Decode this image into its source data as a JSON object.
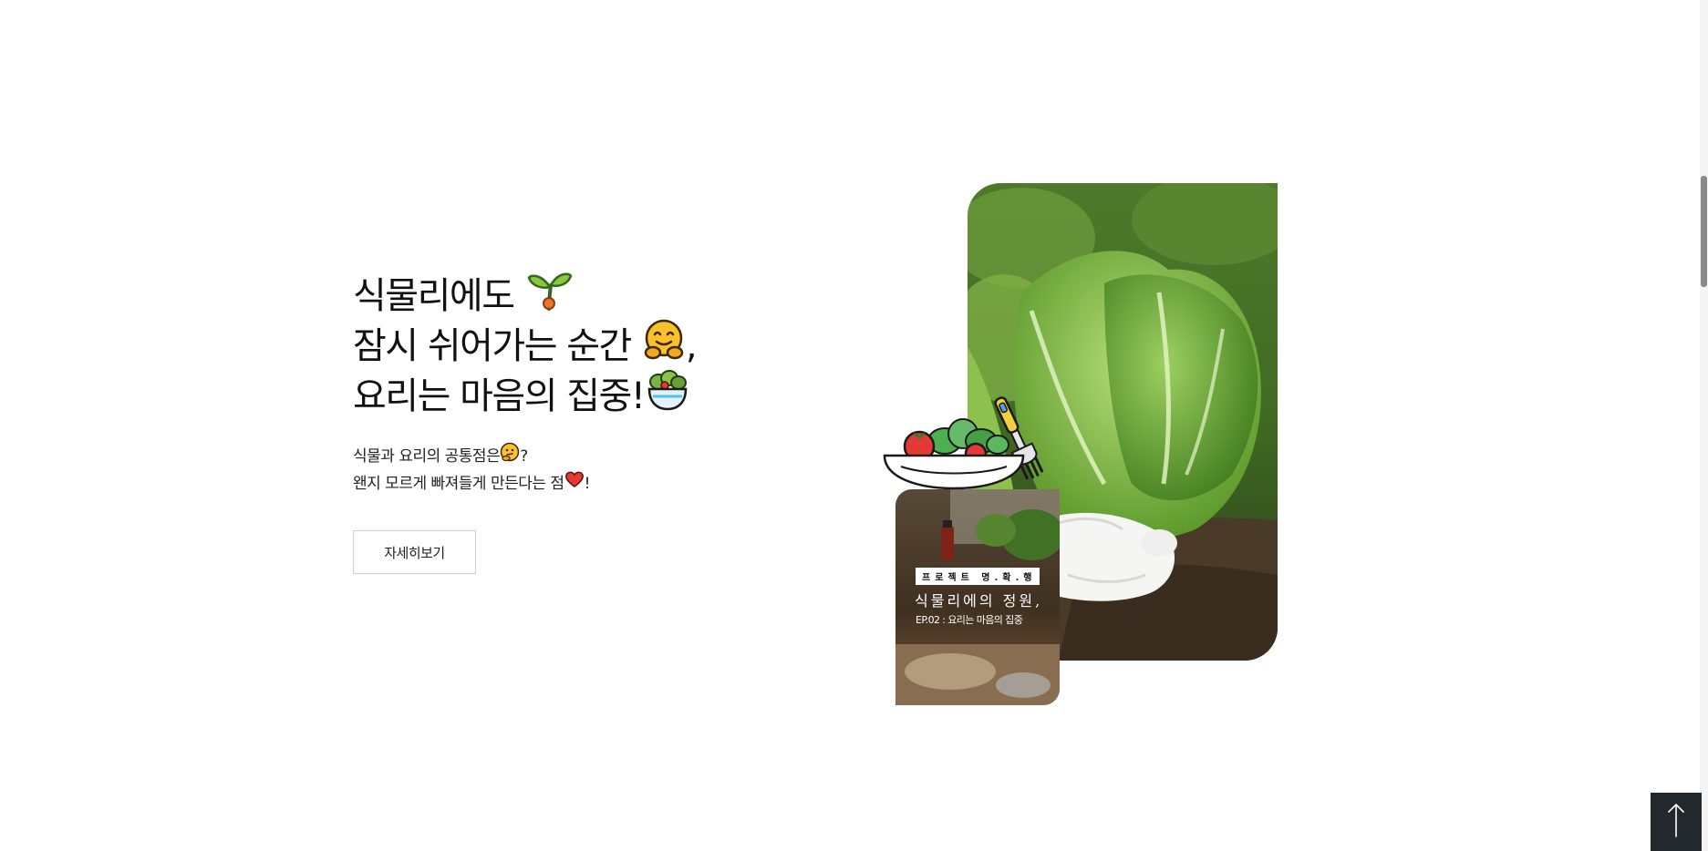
{
  "hero": {
    "headline_lines": [
      {
        "text": "식물리에도",
        "emoji": "sprout-icon"
      },
      {
        "text": "잠시 쉬어가는 순간",
        "emoji": "hugging-face-icon",
        "suffix": ","
      },
      {
        "text": "요리는 마음의 집중!",
        "emoji": "green-salad-icon"
      }
    ],
    "sub_lines": [
      {
        "text": "식물과 요리의 공통점은",
        "emoji": "thinking-face-icon",
        "suffix": "?"
      },
      {
        "text": "왠지 모르게 빠져들게 만든다는 점",
        "emoji": "heart-icon",
        "suffix": "!"
      }
    ],
    "more_button_label": "자세히보기"
  },
  "card": {
    "tag": "프로젝트 명.확.행",
    "title": "식물리에의 정원,",
    "subtitle": "EP.02 : 요리는 마음의 집중"
  },
  "colors": {
    "text": "#111111",
    "button_border": "#cfcfcf",
    "top_button_bg": "#23282c",
    "leaf_green": "#6fa83a"
  }
}
